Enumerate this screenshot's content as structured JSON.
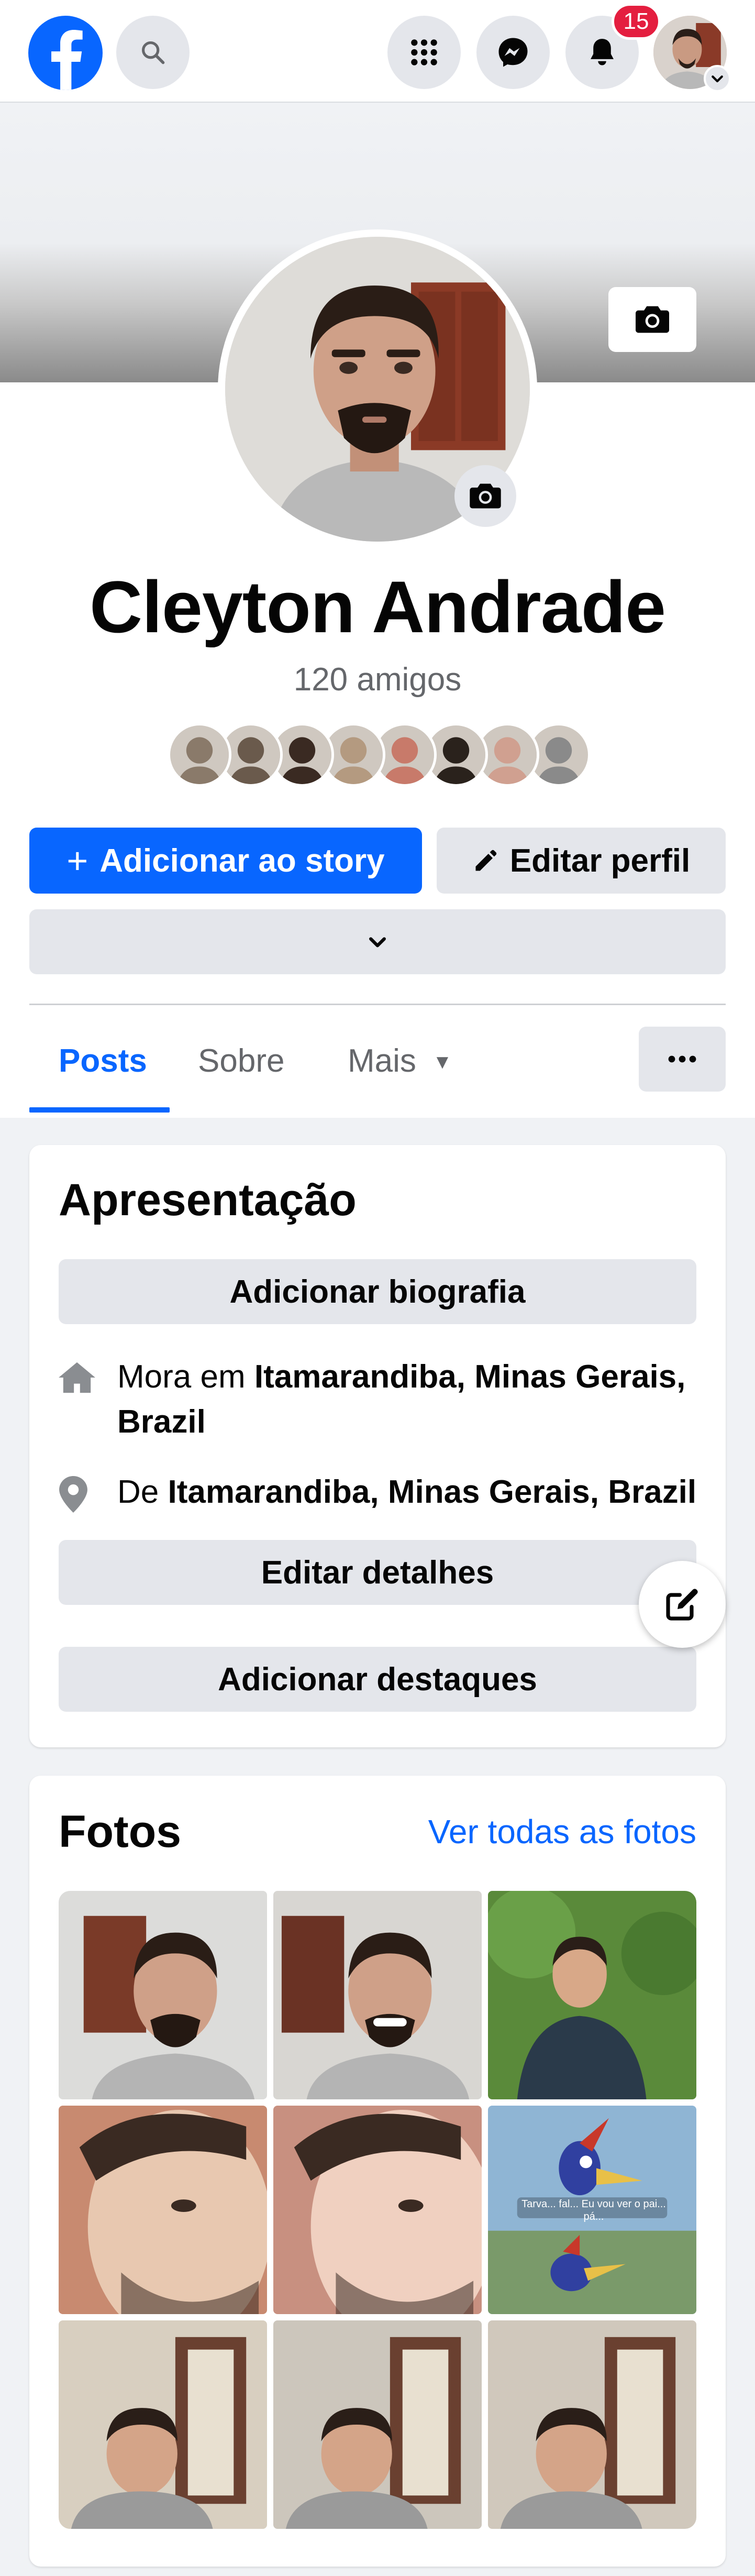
{
  "header": {
    "logo": "facebook-logo",
    "notifications_badge": "15",
    "icons": [
      "search-icon",
      "menu-grid-icon",
      "messenger-icon",
      "bell-icon",
      "account-avatar",
      "chevron-down-icon"
    ]
  },
  "profile": {
    "name": "Cleyton Andrade",
    "friends_count": "120 amigos",
    "friend_faces": [
      "#8a7a6a",
      "#6a5a4c",
      "#3a2a22",
      "#b49a80",
      "#c87a6a",
      "#2a221c",
      "#d0a090",
      "#8a8a8a"
    ]
  },
  "actions": {
    "add_story_label": "Adicionar ao story",
    "edit_profile_label": "Editar perfil"
  },
  "tabs": {
    "posts": "Posts",
    "about": "Sobre",
    "more": "Mais"
  },
  "intro": {
    "title": "Apresentação",
    "add_bio": "Adicionar biografia",
    "lives_prefix": "Mora em ",
    "lives_place": "Itamarandiba, Minas Gerais, Brazil",
    "from_prefix": "De ",
    "from_place": "Itamarandiba, Minas Gerais, Brazil",
    "edit_details": "Editar detalhes",
    "add_featured": "Adicionar destaques"
  },
  "photos": {
    "title": "Fotos",
    "see_all": "Ver todas as fotos",
    "items": [
      {
        "bg": "#dcdcda",
        "accent": "#7a3a28"
      },
      {
        "bg": "#d8d6d2",
        "accent": "#6a3224"
      },
      {
        "bg": "#5a8a3a",
        "accent": "#2a3a4a"
      },
      {
        "bg": "#c88a70",
        "accent": "#e8c8b0"
      },
      {
        "bg": "#c89080",
        "accent": "#f0d0c0"
      },
      {
        "bg": "#7aa0c0",
        "accent": "#c8382a"
      },
      {
        "bg": "#d8cfc0",
        "accent": "#6a4030"
      },
      {
        "bg": "#ccc6bc",
        "accent": "#6a4030"
      },
      {
        "bg": "#d0c8bc",
        "accent": "#6a4030"
      }
    ],
    "woodpecker_caption": "Tarva... fal... Eu vou ver o pai... pá..."
  },
  "colors": {
    "accent": "#0866ff",
    "badge": "#e41e3f",
    "button_gray": "#e4e6eb",
    "secondary_text": "#65676b"
  }
}
